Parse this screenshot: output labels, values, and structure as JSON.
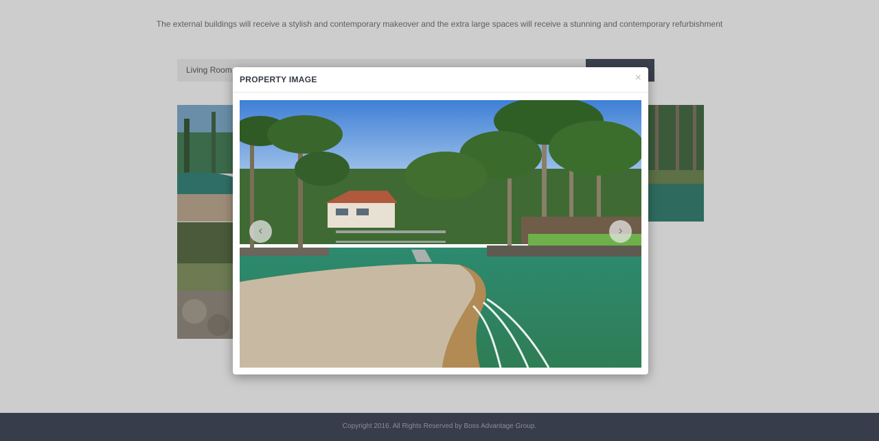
{
  "intro_text": "The external buildings will receive a stylish and contemporary makeover and the extra large spaces will receive a stunning and contemporary refurbishment",
  "tabs": [
    {
      "label": "Living Room"
    },
    {
      "label": ""
    }
  ],
  "modal": {
    "title": "PROPERTY IMAGE",
    "close_glyph": "×",
    "prev_glyph": "‹",
    "next_glyph": "›"
  },
  "footer": {
    "copyright": "Copyright 2016. All Rights Reserved by Boss Advantage Group."
  },
  "colors": {
    "footer_bg": "#373d4a",
    "active_tab_bg": "#3a404c",
    "overlay_bg": "#cdcdcd"
  },
  "icons": {
    "close": "close-icon",
    "prev": "chevron-left-icon",
    "next": "chevron-right-icon"
  }
}
